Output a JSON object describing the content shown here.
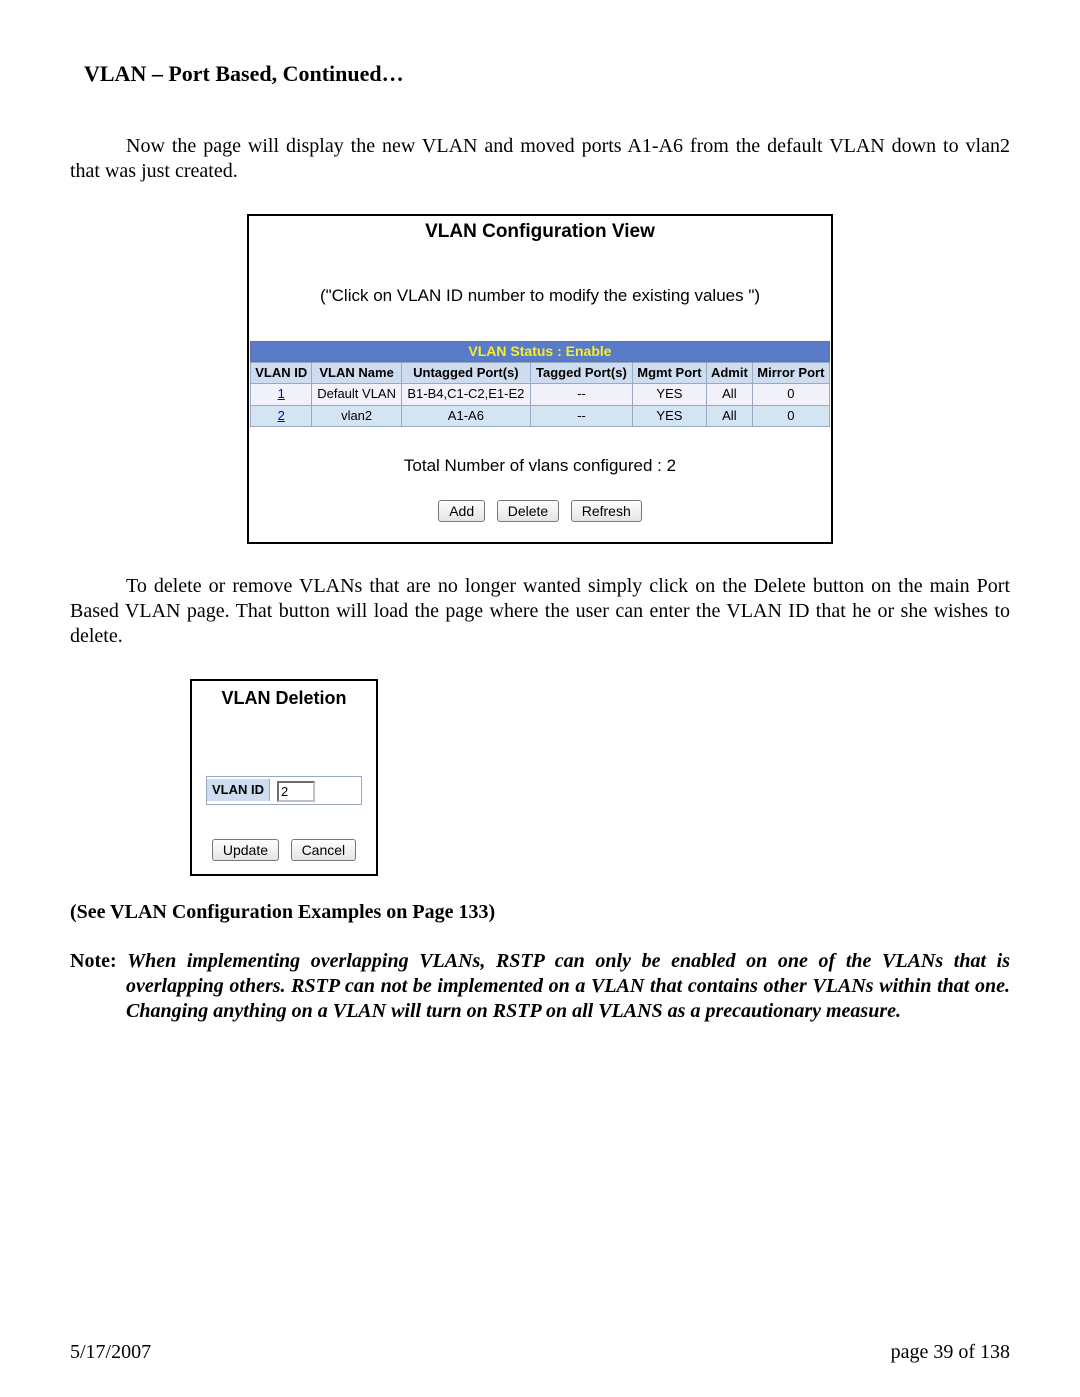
{
  "doc": {
    "heading": "VLAN – Port Based, Continued…",
    "para1": "Now the page will display the new VLAN and moved ports A1-A6 from the default VLAN down to vlan2 that was just created.",
    "para2": "To delete or remove VLANs that are no longer wanted simply click on the Delete button on the main Port Based VLAN page.  That button will load the page where the user can enter the VLAN ID that he or she wishes to delete.",
    "see_line": "(See VLAN Configuration Examples on Page 133)",
    "note_label": "Note: ",
    "note_body": "When implementing overlapping VLANs, RSTP can only be enabled on one of the VLANs that is overlapping others.  RSTP can not be implemented on a VLAN that contains other VLANs within that one.  Changing anything on a VLAN will turn on RSTP on all VLANS as a precautionary measure."
  },
  "view": {
    "title": "VLAN Configuration View",
    "hint": "(\"Click on VLAN ID number to modify the existing values \")",
    "status_bar": "VLAN Status   :   Enable",
    "headers": {
      "id": "VLAN ID",
      "name": "VLAN Name",
      "untagged": "Untagged Port(s)",
      "tagged": "Tagged Port(s)",
      "mgmt": "Mgmt Port",
      "admit": "Admit",
      "mirror": "Mirror Port"
    },
    "rows": [
      {
        "id": "1",
        "name": "Default VLAN",
        "untagged": "B1-B4,C1-C2,E1-E2",
        "tagged": "--",
        "mgmt": "YES",
        "admit": "All",
        "mirror": "0"
      },
      {
        "id": "2",
        "name": "vlan2",
        "untagged": "A1-A6",
        "tagged": "--",
        "mgmt": "YES",
        "admit": "All",
        "mirror": "0"
      }
    ],
    "total": "Total Number of vlans configured : 2",
    "buttons": {
      "add": "Add",
      "delete": "Delete",
      "refresh": "Refresh"
    }
  },
  "deletion": {
    "title": "VLAN Deletion",
    "field_label": "VLAN ID",
    "field_value": "2",
    "buttons": {
      "update": "Update",
      "cancel": "Cancel"
    }
  },
  "footer": {
    "date": "5/17/2007",
    "page": "page 39 of 138"
  }
}
